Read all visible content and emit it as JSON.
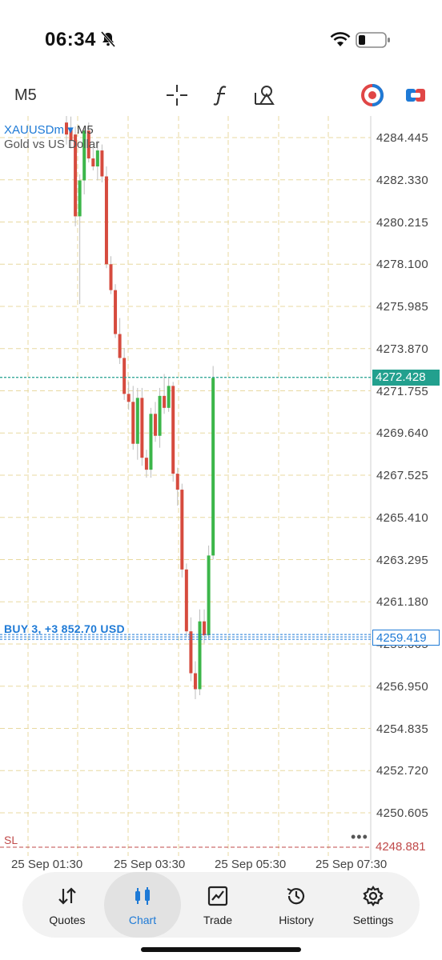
{
  "status_bar": {
    "time": "06:34"
  },
  "toolbar": {
    "timeframe": "M5",
    "icons": [
      "crosshair-icon",
      "indicators-icon",
      "objects-icon",
      "one-click-trading-icon",
      "trade-panel-icon"
    ]
  },
  "chart": {
    "symbol": "XAUUSDm",
    "symbol_arrow": "▾",
    "timeframe": "M5",
    "description": "Gold vs US Dollar",
    "current_price": "4272.428",
    "position_label": "BUY 3, +3 852.70 USD",
    "position_price": "4259.419",
    "sl_label": "SL",
    "sl_price": "4248.881",
    "more_label": "•••",
    "colors": {
      "bull": "#3cb64a",
      "bear": "#d64b3e",
      "current_line": "#22a08e",
      "position_line": "#1e7ad6",
      "sl_line": "#c04a4a",
      "grid": "#e8d9a0"
    }
  },
  "chart_data": {
    "type": "candlestick",
    "y_ticks": [
      "4284.445",
      "4282.330",
      "4280.215",
      "4278.100",
      "4275.985",
      "4273.870",
      "4271.755",
      "4269.640",
      "4267.525",
      "4265.410",
      "4263.295",
      "4261.180",
      "4259.065",
      "4256.950",
      "4254.835",
      "4252.720",
      "4250.605"
    ],
    "x_ticks": [
      "25 Sep 01:30",
      "25 Sep 03:30",
      "25 Sep 05:30",
      "25 Sep 07:30"
    ],
    "ylim": [
      4248.5,
      4285.5
    ],
    "candles": [
      {
        "o": 4285.2,
        "h": 4285.8,
        "l": 4284.1,
        "c": 4284.6
      },
      {
        "o": 4284.9,
        "h": 4285.5,
        "l": 4283.9,
        "c": 4284.3
      },
      {
        "o": 4284.6,
        "h": 4285.0,
        "l": 4280.0,
        "c": 4280.5
      },
      {
        "o": 4280.5,
        "h": 4282.6,
        "l": 4276.1,
        "c": 4282.3
      },
      {
        "o": 4282.3,
        "h": 4285.0,
        "l": 4281.6,
        "c": 4284.8
      },
      {
        "o": 4284.8,
        "h": 4285.2,
        "l": 4283.2,
        "c": 4283.4
      },
      {
        "o": 4283.4,
        "h": 4284.0,
        "l": 4282.8,
        "c": 4283.0
      },
      {
        "o": 4283.0,
        "h": 4284.3,
        "l": 4282.3,
        "c": 4283.8
      },
      {
        "o": 4283.8,
        "h": 4284.1,
        "l": 4282.2,
        "c": 4282.5
      },
      {
        "o": 4282.5,
        "h": 4283.0,
        "l": 4277.9,
        "c": 4278.1
      },
      {
        "o": 4278.1,
        "h": 4278.5,
        "l": 4276.6,
        "c": 4276.8
      },
      {
        "o": 4276.8,
        "h": 4277.1,
        "l": 4274.4,
        "c": 4274.6
      },
      {
        "o": 4274.6,
        "h": 4275.4,
        "l": 4273.1,
        "c": 4273.4
      },
      {
        "o": 4273.4,
        "h": 4273.9,
        "l": 4271.3,
        "c": 4271.6
      },
      {
        "o": 4271.6,
        "h": 4272.2,
        "l": 4270.8,
        "c": 4271.2
      },
      {
        "o": 4271.2,
        "h": 4272.0,
        "l": 4268.8,
        "c": 4269.1
      },
      {
        "o": 4269.1,
        "h": 4271.9,
        "l": 4268.3,
        "c": 4271.4
      },
      {
        "o": 4271.4,
        "h": 4271.9,
        "l": 4268.0,
        "c": 4268.4
      },
      {
        "o": 4268.4,
        "h": 4268.8,
        "l": 4267.4,
        "c": 4267.8
      },
      {
        "o": 4267.8,
        "h": 4270.9,
        "l": 4267.4,
        "c": 4270.6
      },
      {
        "o": 4270.6,
        "h": 4271.2,
        "l": 4269.2,
        "c": 4269.5
      },
      {
        "o": 4269.5,
        "h": 4271.9,
        "l": 4268.9,
        "c": 4271.5
      },
      {
        "o": 4271.5,
        "h": 4272.6,
        "l": 4270.6,
        "c": 4270.9
      },
      {
        "o": 4270.9,
        "h": 4272.4,
        "l": 4270.7,
        "c": 4272.0
      },
      {
        "o": 4272.0,
        "h": 4272.2,
        "l": 4267.2,
        "c": 4267.6
      },
      {
        "o": 4267.6,
        "h": 4267.9,
        "l": 4266.0,
        "c": 4266.8
      },
      {
        "o": 4266.8,
        "h": 4267.1,
        "l": 4262.4,
        "c": 4262.8
      },
      {
        "o": 4262.8,
        "h": 4263.1,
        "l": 4259.4,
        "c": 4259.7
      },
      {
        "o": 4259.7,
        "h": 4260.4,
        "l": 4257.2,
        "c": 4257.6
      },
      {
        "o": 4257.6,
        "h": 4258.2,
        "l": 4256.3,
        "c": 4256.8
      },
      {
        "o": 4256.8,
        "h": 4260.8,
        "l": 4256.5,
        "c": 4260.2
      },
      {
        "o": 4260.2,
        "h": 4260.8,
        "l": 4259.1,
        "c": 4259.5
      },
      {
        "o": 4259.5,
        "h": 4264.0,
        "l": 4259.3,
        "c": 4263.5
      },
      {
        "o": 4263.5,
        "h": 4273.0,
        "l": 4263.3,
        "c": 4272.4
      }
    ]
  },
  "nav": [
    {
      "label": "Quotes",
      "icon": "quotes-icon"
    },
    {
      "label": "Chart",
      "icon": "chart-icon"
    },
    {
      "label": "Trade",
      "icon": "trade-icon"
    },
    {
      "label": "History",
      "icon": "history-icon"
    },
    {
      "label": "Settings",
      "icon": "settings-icon"
    }
  ]
}
